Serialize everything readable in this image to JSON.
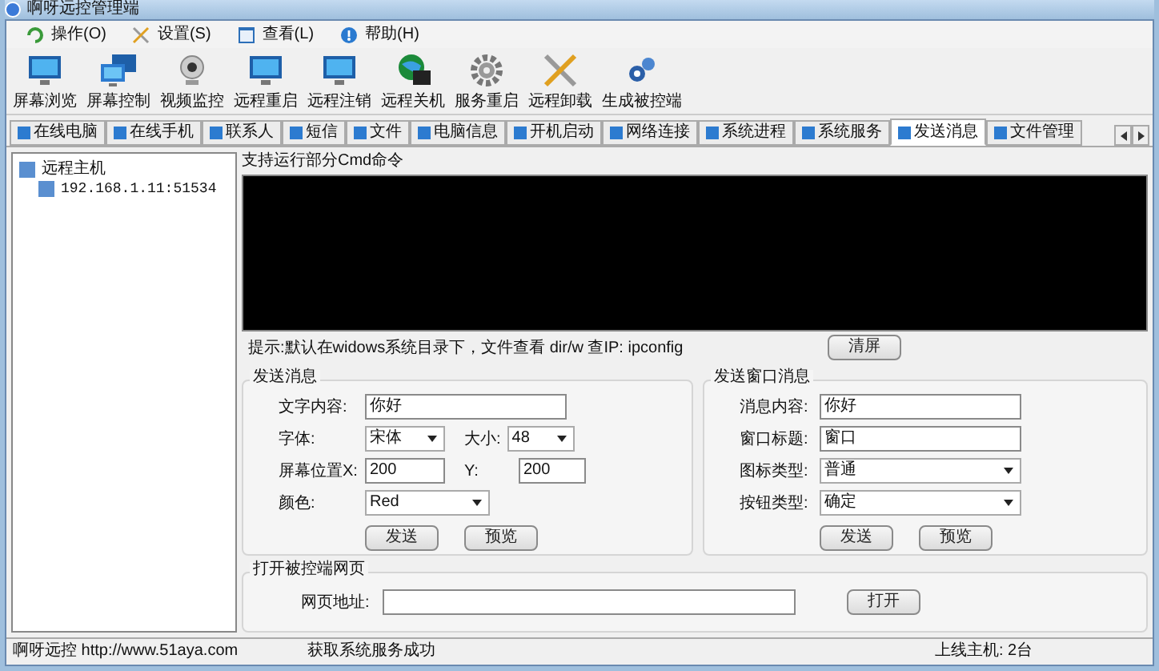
{
  "window": {
    "title": "啊呀远控管理端"
  },
  "menu": [
    {
      "label": "操作(O)",
      "kind": "refresh"
    },
    {
      "label": "设置(S)",
      "kind": "tools"
    },
    {
      "label": "查看(L)",
      "kind": "window"
    },
    {
      "label": "帮助(H)",
      "kind": "help"
    }
  ],
  "toolbar": [
    {
      "label": "屏幕浏览",
      "kind": "monitor"
    },
    {
      "label": "屏幕控制",
      "kind": "monitors"
    },
    {
      "label": "视频监控",
      "kind": "webcam"
    },
    {
      "label": "远程重启",
      "kind": "monitor"
    },
    {
      "label": "远程注销",
      "kind": "monitor"
    },
    {
      "label": "远程关机",
      "kind": "globe"
    },
    {
      "label": "服务重启",
      "kind": "gear"
    },
    {
      "label": "远程卸载",
      "kind": "tools"
    },
    {
      "label": "生成被控端",
      "kind": "gears"
    }
  ],
  "tabs": [
    {
      "label": "在线电脑",
      "selected": false
    },
    {
      "label": "在线手机",
      "selected": false
    },
    {
      "label": "联系人",
      "selected": false
    },
    {
      "label": "短信",
      "selected": false
    },
    {
      "label": "文件",
      "selected": false
    },
    {
      "label": "电脑信息",
      "selected": false
    },
    {
      "label": "开机启动",
      "selected": false
    },
    {
      "label": "网络连接",
      "selected": false
    },
    {
      "label": "系统进程",
      "selected": false
    },
    {
      "label": "系统服务",
      "selected": false
    },
    {
      "label": "发送消息",
      "selected": true
    },
    {
      "label": "文件管理",
      "selected": false
    }
  ],
  "tree": {
    "label": "远程主机",
    "children": [
      {
        "label": "192.168.1.11:51534"
      }
    ]
  },
  "cmd": {
    "title": "支持运行部分Cmd命令",
    "hint": "提示:默认在widows系统目录下，文件查看 dir/w 查IP: ipconfig",
    "clear_button": "清屏"
  },
  "send_message": {
    "title": "发送消息",
    "content_label": "文字内容:",
    "content_value": "你好",
    "font_label": "字体:",
    "font_value": "宋体",
    "size_label": "大小:",
    "size_value": "48",
    "x_label": "屏幕位置X:",
    "x_value": "200",
    "y_label": "Y:",
    "y_value": "200",
    "color_label": "颜色:",
    "color_value": "Red",
    "buttons": [
      "发送",
      "预览"
    ]
  },
  "window_message": {
    "title": "发送窗口消息",
    "rows": [
      {
        "kind": "input",
        "label": "消息内容:",
        "value": "你好"
      },
      {
        "kind": "input",
        "label": "窗口标题:",
        "value": "窗口"
      },
      {
        "kind": "select",
        "label": "图标类型:",
        "value": "普通"
      },
      {
        "kind": "select",
        "label": "按钮类型:",
        "value": "确定"
      }
    ],
    "buttons": [
      "发送",
      "预览"
    ]
  },
  "open_webpage": {
    "title": "打开被控端网页",
    "url_label": "网页地址:",
    "button": "打开"
  },
  "status_bar": [
    {
      "text": "啊呀远控 http://www.51aya.com"
    },
    {
      "text": "获取系统服务成功"
    },
    {
      "text": "上线主机: 2台"
    }
  ]
}
